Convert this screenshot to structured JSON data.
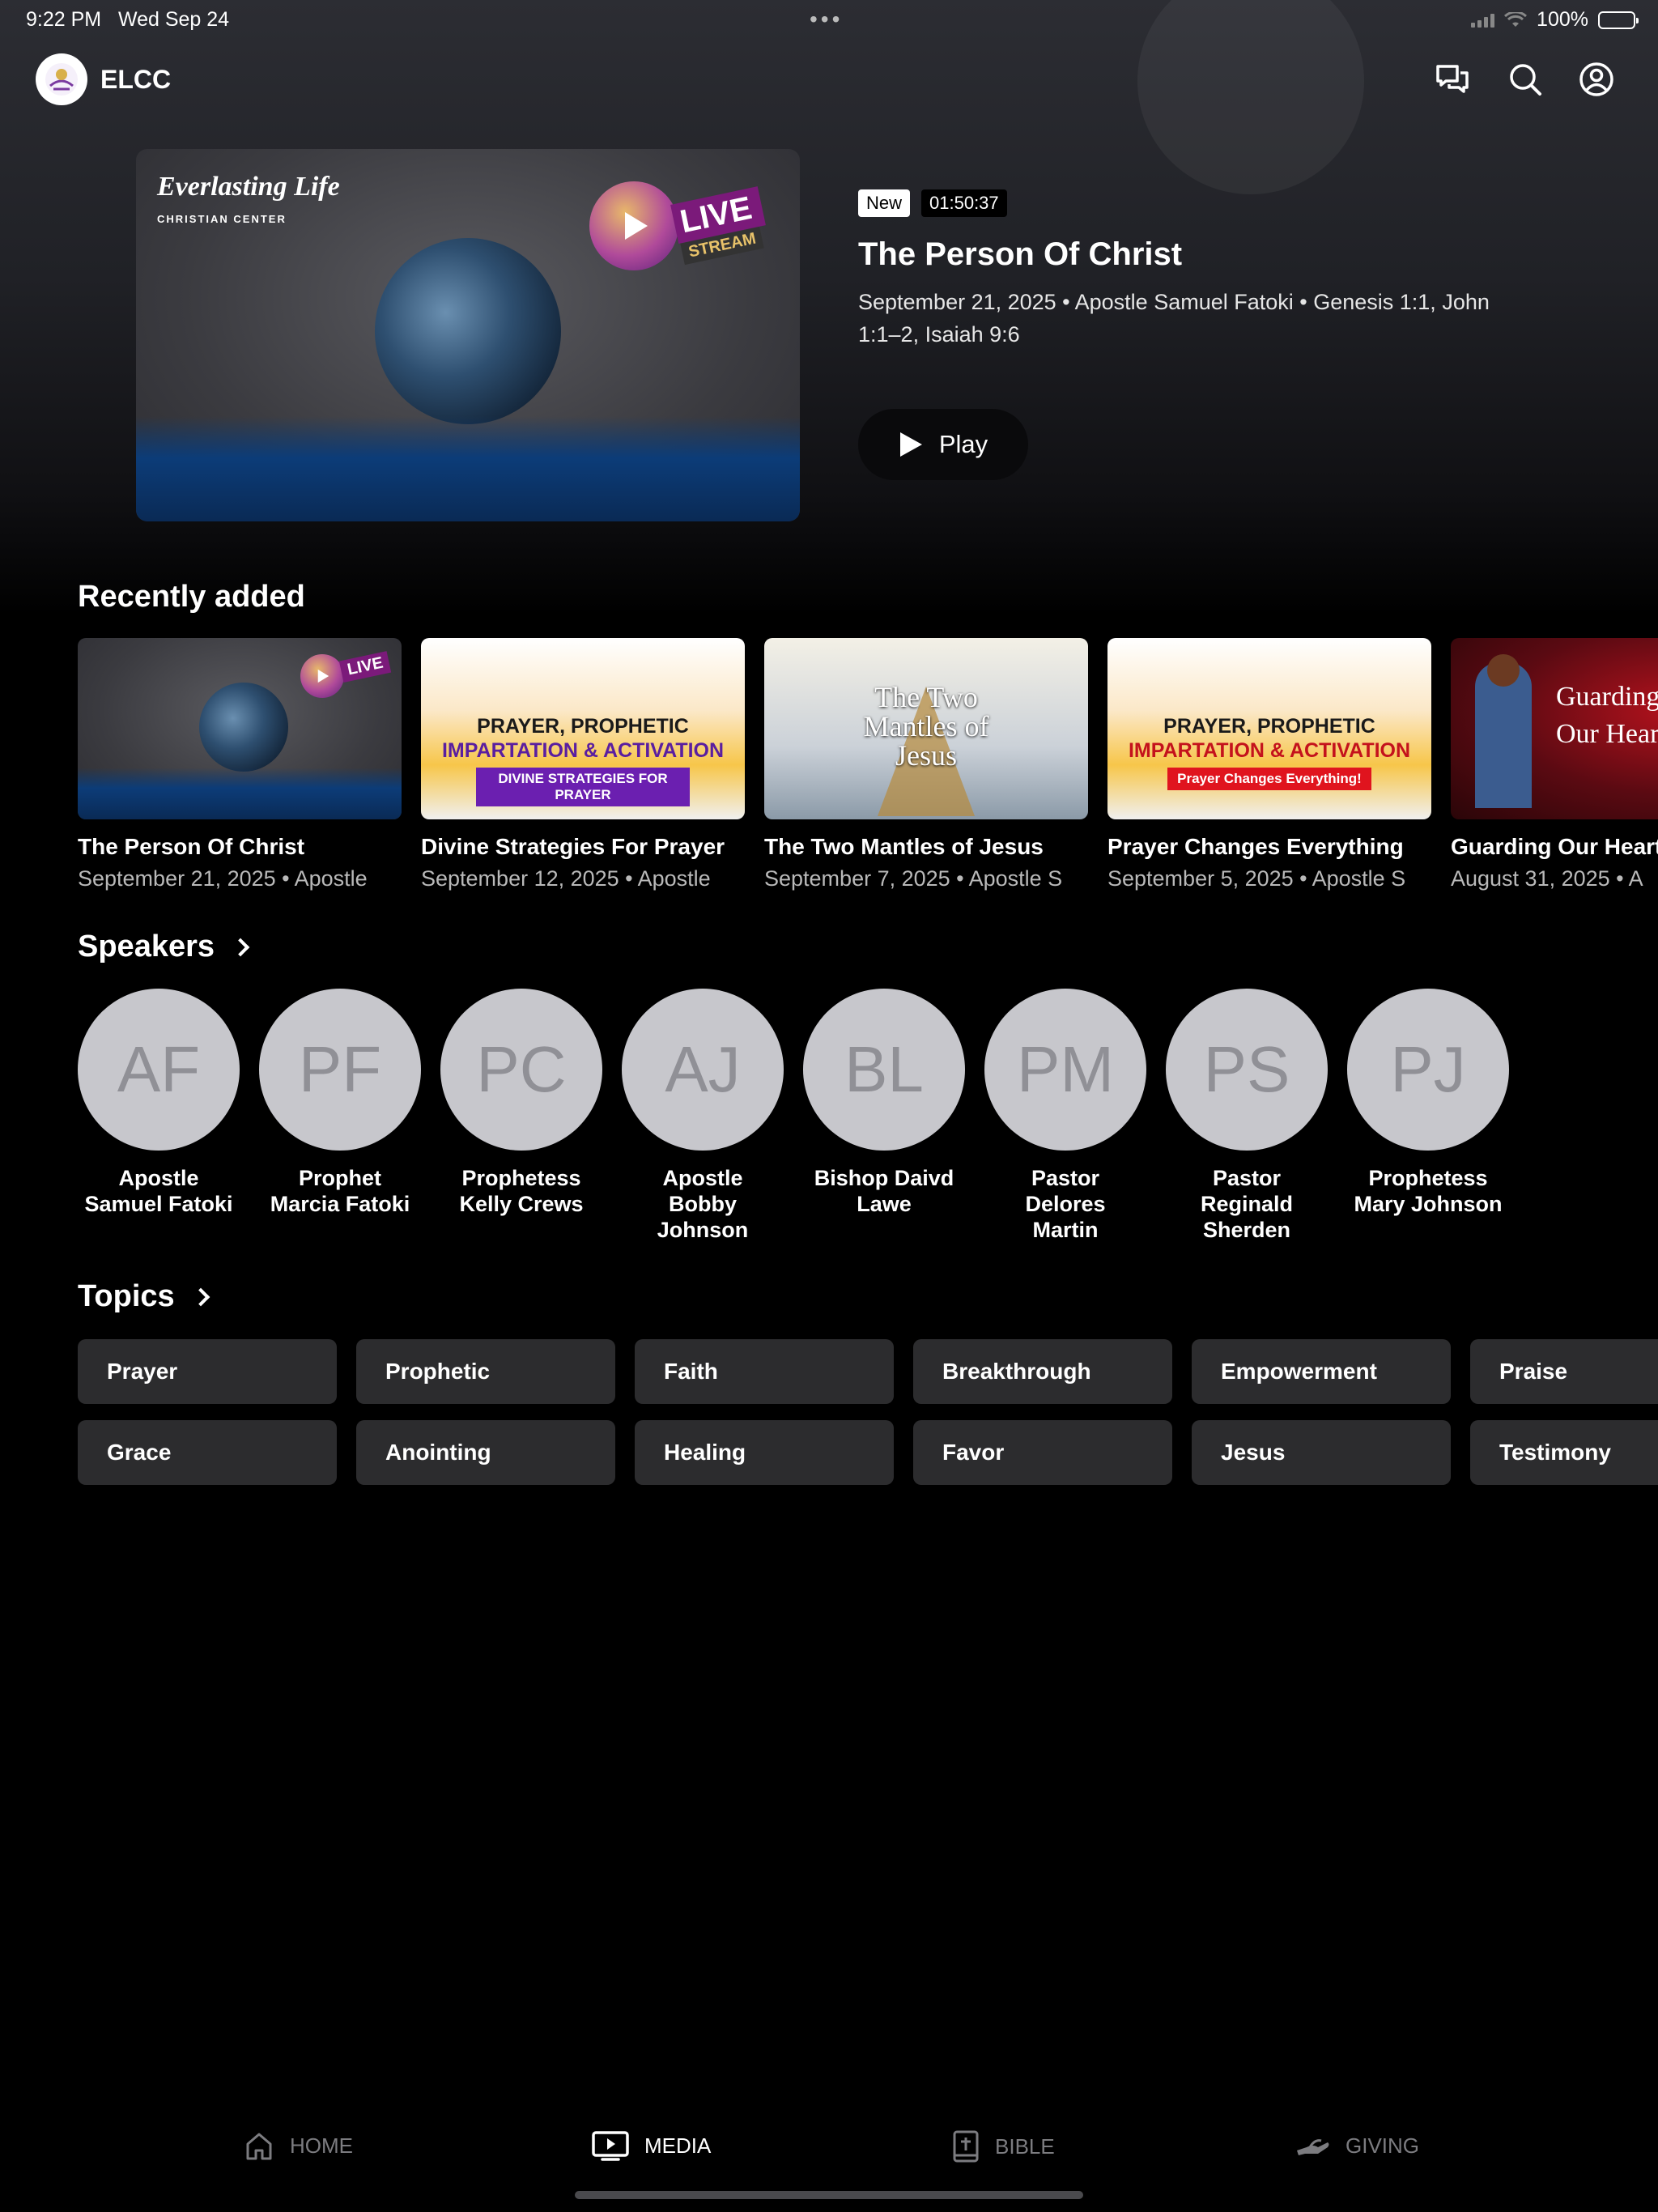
{
  "status_bar": {
    "time": "9:22 PM",
    "date": "Wed Sep 24",
    "battery": "100%",
    "battery_level": 1.0
  },
  "header": {
    "title": "ELCC",
    "icons": [
      "chat-icon",
      "search-icon",
      "account-icon"
    ]
  },
  "featured": {
    "badge_new": "New",
    "duration": "01:50:37",
    "title": "The Person Of Christ",
    "meta": "September 21, 2025 • Apostle Samuel Fatoki • Genesis 1:1, John 1:1–2, Isaiah 9:6",
    "play_label": "Play",
    "thumb_logo": "Everlasting Life",
    "thumb_logo_sub": "CHRISTIAN CENTER",
    "thumb_live": "LIVE",
    "thumb_stream": "STREAM"
  },
  "recently_added": {
    "title": "Recently added",
    "items": [
      {
        "title": "The Person Of Christ",
        "subtitle": "September 21, 2025 • Apostle",
        "art": "live"
      },
      {
        "title": "Divine Strategies For Prayer",
        "subtitle": "September 12, 2025 • Apostle",
        "art": "friday",
        "art_line1": "PRAYER, PROPHETIC",
        "art_line2": "IMPARTATION & ACTIVATION",
        "art_banner": "DIVINE STRATEGIES FOR PRAYER",
        "banner_color": "#6b1fb0"
      },
      {
        "title": "The Two Mantles of Jesus",
        "subtitle": "September 7, 2025 • Apostle S",
        "art": "mantles",
        "art_line1": "The Two",
        "art_line2": "Mantles of",
        "art_line3": "Jesus"
      },
      {
        "title": "Prayer Changes Everything",
        "subtitle": "September 5, 2025 • Apostle S",
        "art": "friday",
        "art_line1": "PRAYER, PROPHETIC",
        "art_line2": "IMPARTATION & ACTIVATION",
        "art_banner": "Prayer Changes Everything!",
        "banner_color": "#e0141e"
      },
      {
        "title": "Guarding Our Hearts",
        "subtitle": "August 31, 2025 • A",
        "art": "guarding",
        "art_line1": "Guarding",
        "art_line2": "Our Hearts"
      }
    ]
  },
  "speakers": {
    "title": "Speakers",
    "items": [
      {
        "initials": "AF",
        "name": "Apostle\nSamuel Fatoki"
      },
      {
        "initials": "PF",
        "name": "Prophet\nMarcia Fatoki"
      },
      {
        "initials": "PC",
        "name": "Prophetess\nKelly Crews"
      },
      {
        "initials": "AJ",
        "name": "Apostle\nBobby\nJohnson"
      },
      {
        "initials": "BL",
        "name": "Bishop Daivd\nLawe"
      },
      {
        "initials": "PM",
        "name": "Pastor\nDelores\nMartin"
      },
      {
        "initials": "PS",
        "name": "Pastor\nReginald\nSherden"
      },
      {
        "initials": "PJ",
        "name": "Prophetess\nMary Johnson"
      }
    ]
  },
  "topics": {
    "title": "Topics",
    "row1": [
      "Prayer",
      "Prophetic",
      "Faith",
      "Breakthrough",
      "Empowerment",
      "Praise"
    ],
    "row2": [
      "Grace",
      "Anointing",
      "Healing",
      "Favor",
      "Jesus",
      "Testimony"
    ]
  },
  "tab_bar": {
    "tabs": [
      {
        "label": "HOME",
        "icon": "home-icon"
      },
      {
        "label": "MEDIA",
        "icon": "media-icon",
        "active": true
      },
      {
        "label": "BIBLE",
        "icon": "bible-icon"
      },
      {
        "label": "GIVING",
        "icon": "giving-icon"
      }
    ]
  },
  "colors": {
    "accent": "#ffffff",
    "topic_bg": "#2c2c2e",
    "avatar_bg": "#c7c7cc",
    "inactive_tab": "#7c7c80"
  }
}
